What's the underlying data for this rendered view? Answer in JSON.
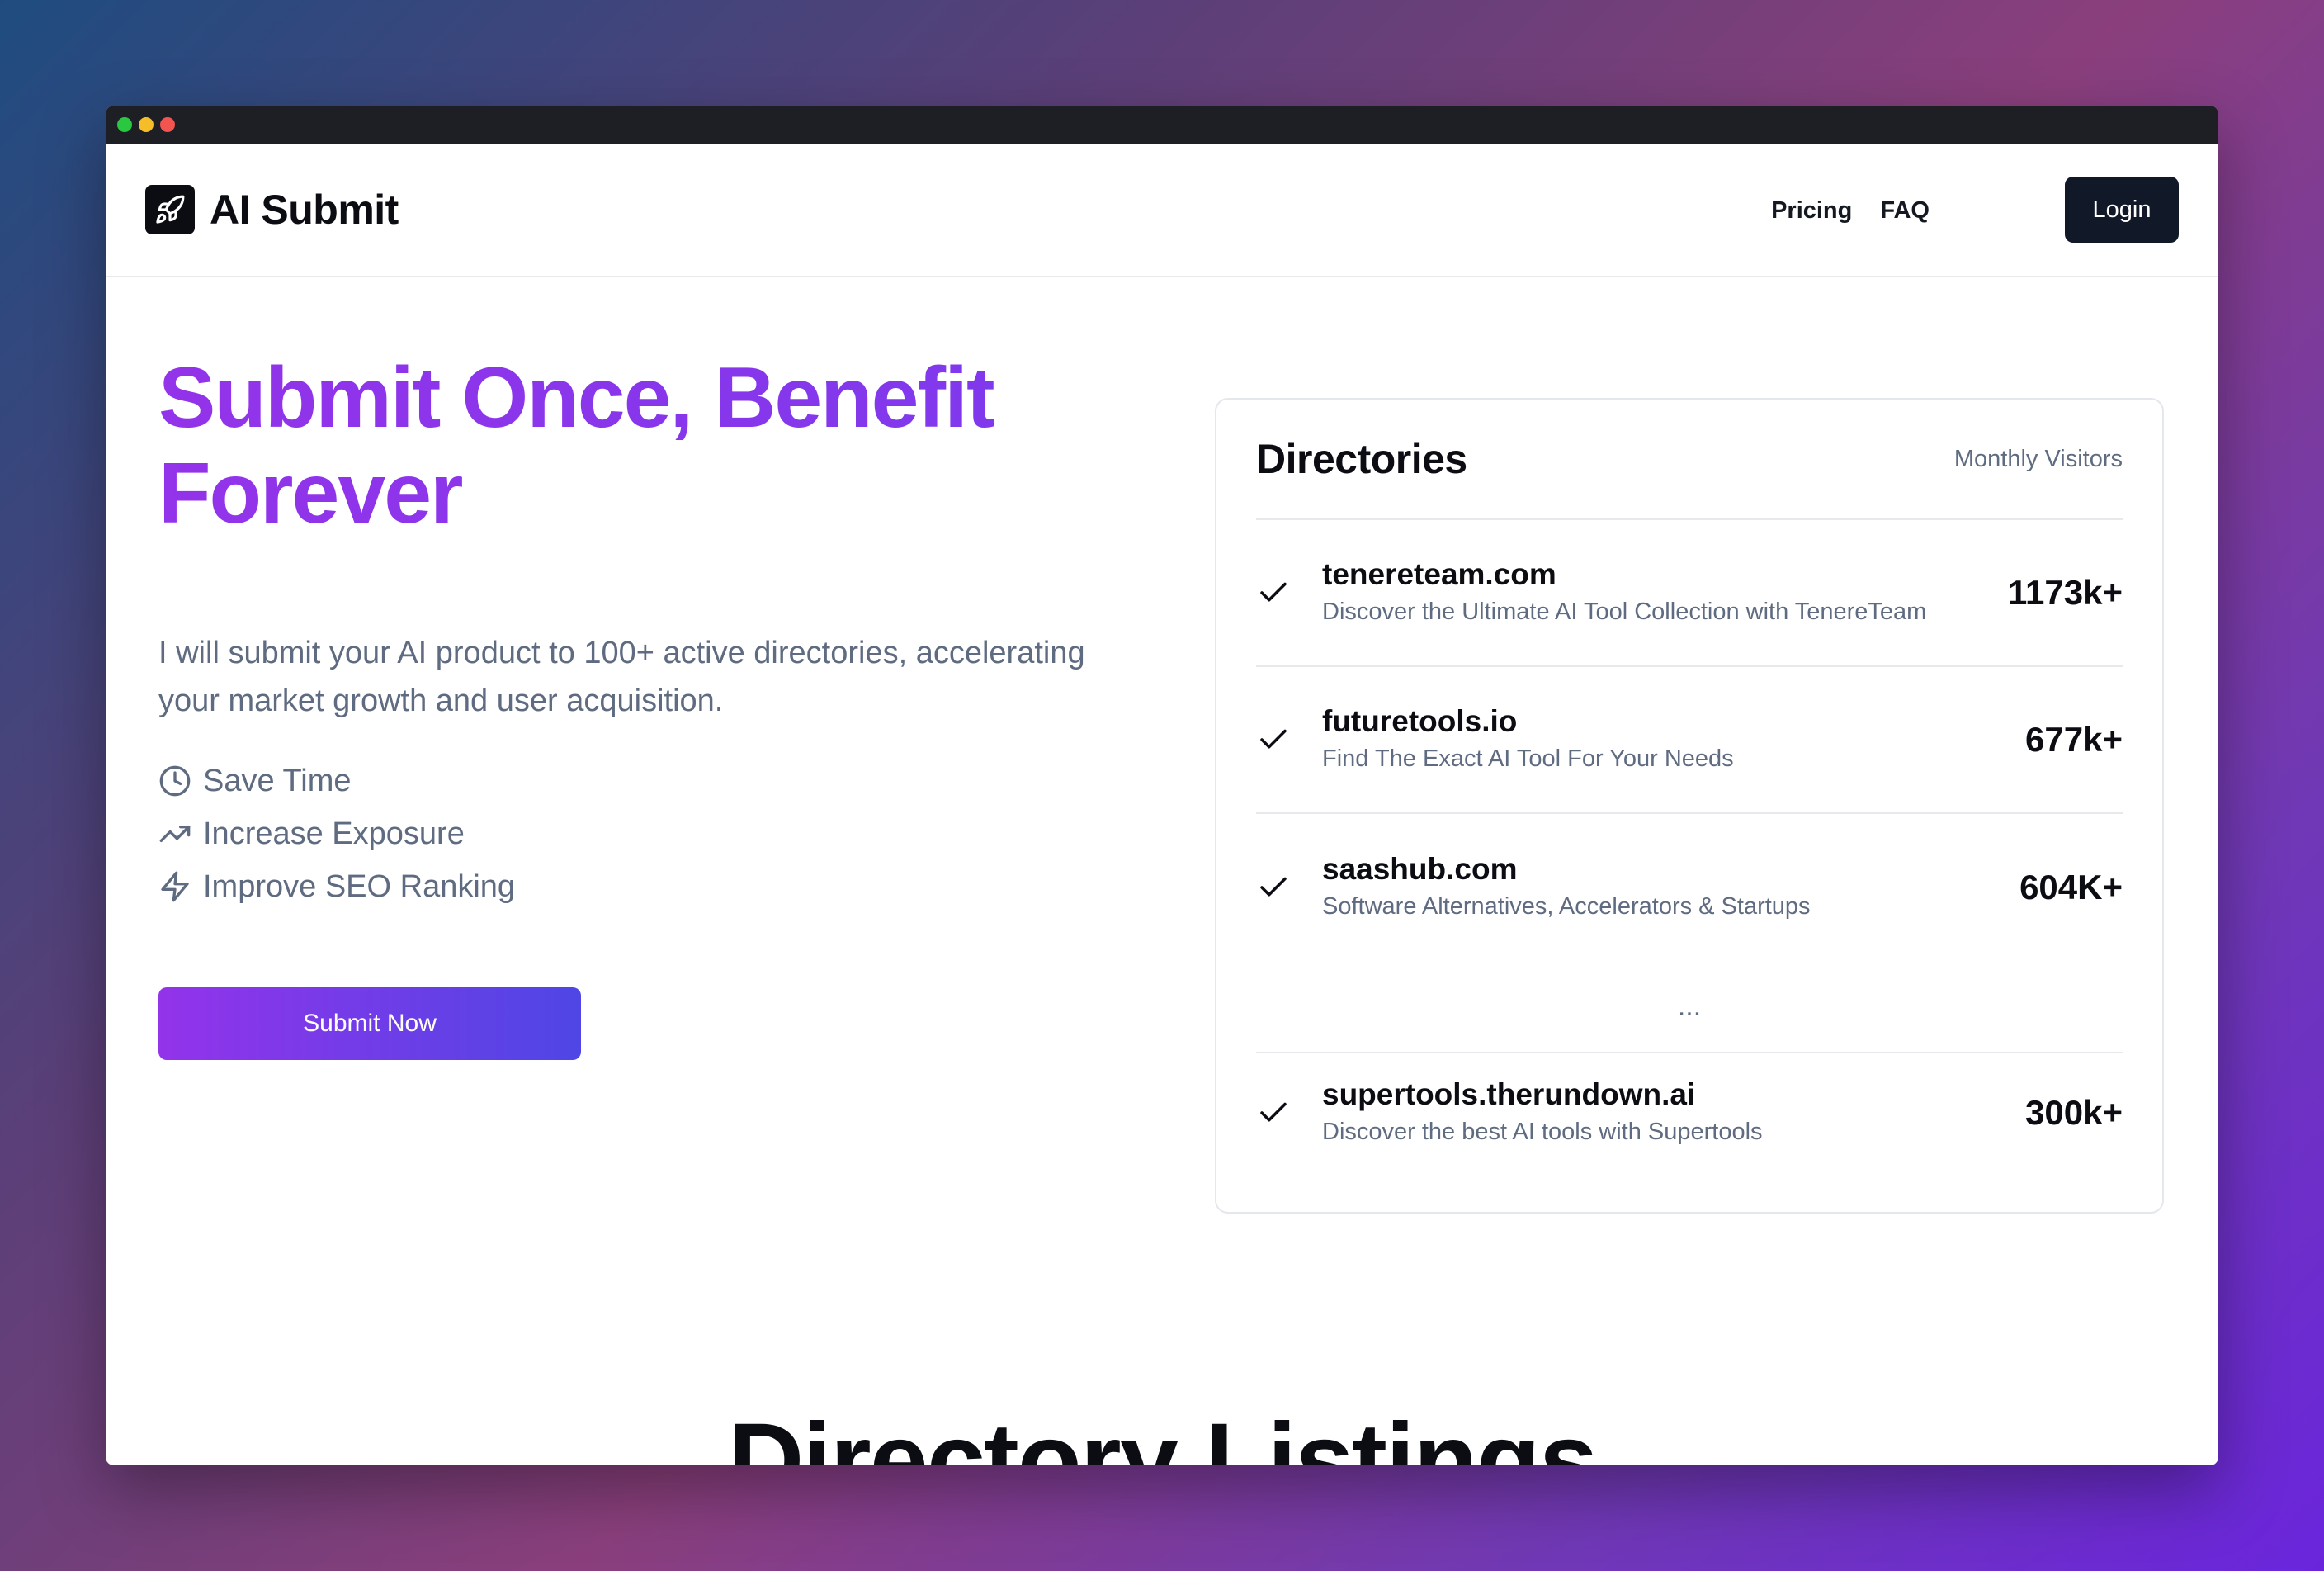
{
  "brand": {
    "name": "AI Submit",
    "logo_icon": "rocket-icon"
  },
  "nav": {
    "links": [
      "Pricing",
      "FAQ"
    ],
    "login_label": "Login"
  },
  "hero": {
    "title": "Submit Once, Benefit Forever",
    "description": "I will submit your AI product to 100+ active directories, accelerating your market growth and user acquisition.",
    "features": [
      {
        "icon": "clock-icon",
        "label": "Save Time"
      },
      {
        "icon": "trending-up-icon",
        "label": "Increase Exposure"
      },
      {
        "icon": "zap-icon",
        "label": "Improve SEO Ranking"
      }
    ],
    "cta_label": "Submit Now"
  },
  "directories_card": {
    "title": "Directories",
    "subtitle": "Monthly Visitors",
    "items": [
      {
        "name": "tenereteam.com",
        "description": "Discover the Ultimate AI Tool Collection with TenereTeam",
        "visitors": "1173k+"
      },
      {
        "name": "futuretools.io",
        "description": "Find The Exact AI Tool For Your Needs",
        "visitors": "677k+"
      },
      {
        "name": "saashub.com",
        "description": "Software Alternatives, Accelerators & Startups",
        "visitors": "604K+"
      }
    ],
    "ellipsis": "...",
    "last_item": {
      "name": "supertools.therundown.ai",
      "description": "Discover the best AI tools with Supertools",
      "visitors": "300k+"
    }
  },
  "section": {
    "title": "Directory Listings"
  },
  "colors": {
    "accent_start": "#9333ea",
    "accent_end": "#4f46e5",
    "dark": "#111827",
    "muted_text": "#5f6b80"
  }
}
